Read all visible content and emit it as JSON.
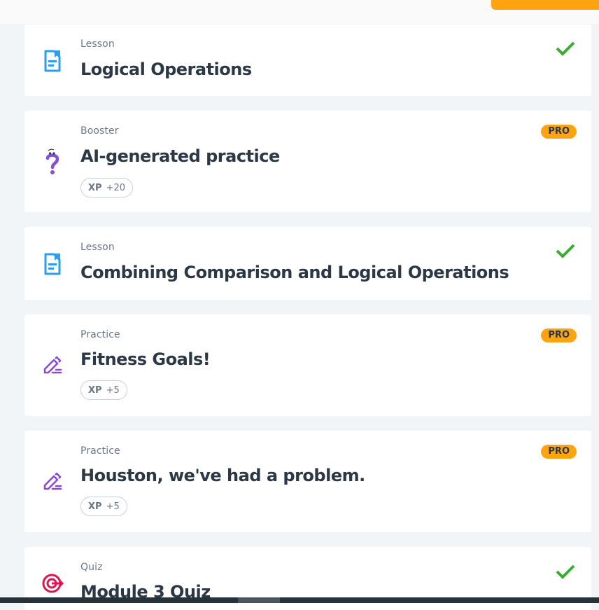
{
  "colors": {
    "accent_orange": "#ffa310",
    "lesson_blue": "#2c9ef2",
    "practice_purple": "#8a4bd6",
    "quiz_red": "#e0154f",
    "check_green": "#3aac2f",
    "title_text": "#2d3846",
    "muted_text": "#6b7785"
  },
  "items": [
    {
      "type": "Lesson",
      "title": "Logical Operations",
      "icon": "lesson-document-icon",
      "completed": true
    },
    {
      "type": "Booster",
      "title": "AI-generated practice",
      "icon": "question-mark-icon",
      "badge": "PRO",
      "xp_label": "XP",
      "xp_value": "+20"
    },
    {
      "type": "Lesson",
      "title": "Combining Comparison and Logical Operations",
      "icon": "lesson-document-icon",
      "completed": true
    },
    {
      "type": "Practice",
      "title": "Fitness Goals!",
      "icon": "pencil-icon",
      "badge": "PRO",
      "xp_label": "XP",
      "xp_value": "+5"
    },
    {
      "type": "Practice",
      "title": "Houston, we've had a problem.",
      "icon": "pencil-icon",
      "badge": "PRO",
      "xp_label": "XP",
      "xp_value": "+5"
    },
    {
      "type": "Quiz",
      "title": "Module 3 Quiz",
      "icon": "target-icon",
      "completed": true
    }
  ]
}
